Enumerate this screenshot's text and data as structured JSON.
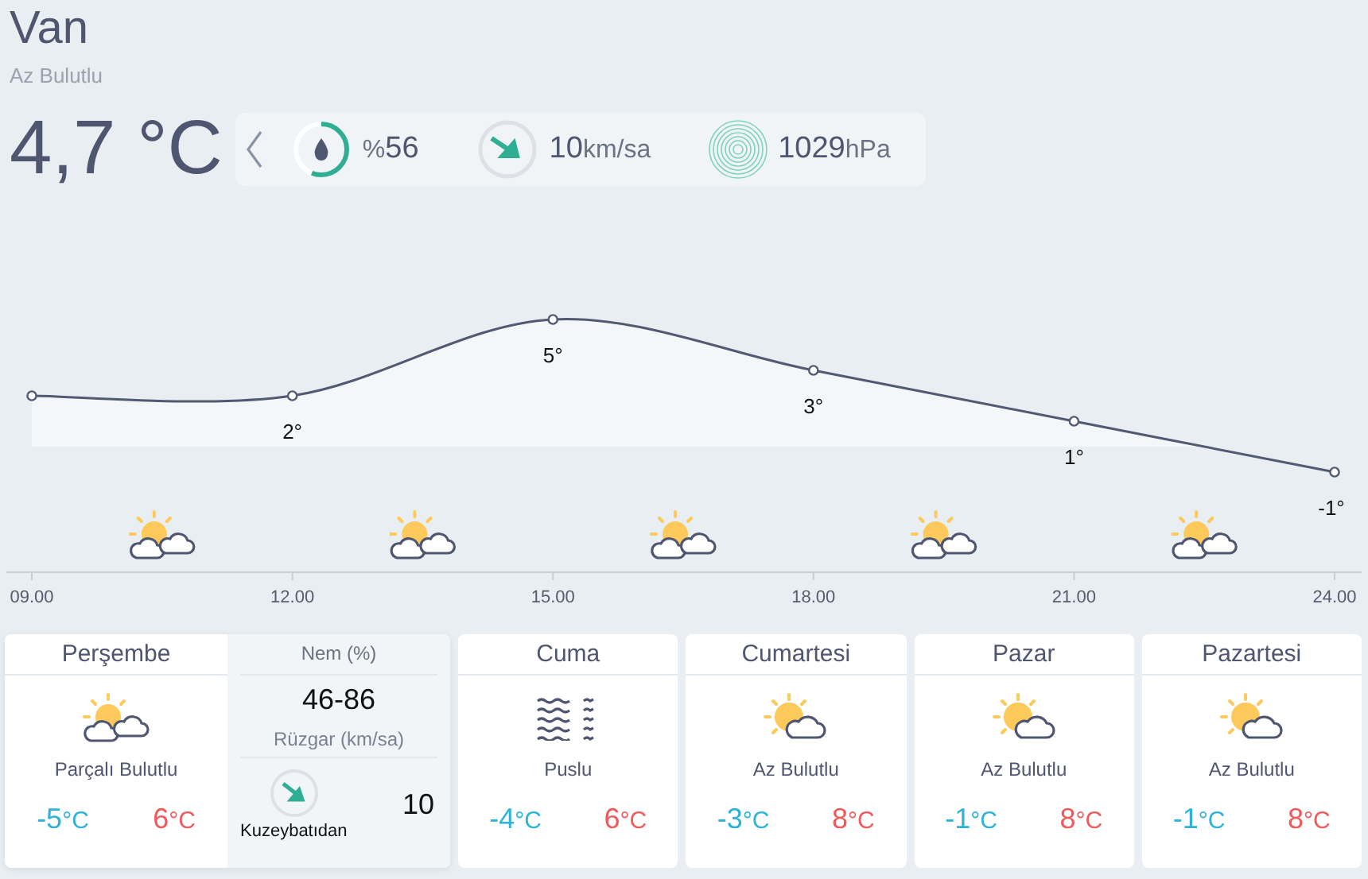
{
  "city": "Van",
  "condition": "Az Bulutlu",
  "temperature": "4,7 °C",
  "stats": {
    "humidity": {
      "prefix": "%",
      "value": "56"
    },
    "wind": {
      "value": "10",
      "unit": "km/sa"
    },
    "pressure": {
      "value": "1029",
      "unit": "hPa"
    }
  },
  "hourly": {
    "chart_data": {
      "type": "area",
      "marker": true,
      "categories": [
        "09.00",
        "12.00",
        "15.00",
        "18.00",
        "21.00",
        "24.00"
      ],
      "values": [
        2,
        2,
        5,
        3,
        1,
        -1
      ],
      "value_labels": [
        null,
        "2°",
        "5°",
        "3°",
        "1°",
        "-1°"
      ]
    },
    "icons": [
      {
        "kind": "partly_cloudy"
      },
      {
        "kind": "partly_cloudy"
      },
      {
        "kind": "partly_cloudy"
      },
      {
        "kind": "partly_cloudy"
      },
      {
        "kind": "partly_cloudy"
      }
    ]
  },
  "days": [
    {
      "name": "Perşembe",
      "kind": "partly_cloudy",
      "condition": "Parçalı Bulutlu",
      "low": "-5",
      "low_unit": "°C",
      "high": "6",
      "high_unit": "°C",
      "selected": true,
      "details": {
        "humidity_label": "Nem (%)",
        "humidity": "46-86",
        "wind_label": "Rüzgar (km/sa)",
        "wind_direction": "Kuzeybatıdan",
        "wind_speed": "10"
      }
    },
    {
      "name": "Cuma",
      "kind": "fog",
      "condition": "Puslu",
      "low": "-4",
      "low_unit": "°C",
      "high": "6",
      "high_unit": "°C",
      "selected": false
    },
    {
      "name": "Cumartesi",
      "kind": "mostly_sunny",
      "condition": "Az Bulutlu",
      "low": "-3",
      "low_unit": "°C",
      "high": "8",
      "high_unit": "°C",
      "selected": false
    },
    {
      "name": "Pazar",
      "kind": "mostly_sunny",
      "condition": "Az Bulutlu",
      "low": "-1",
      "low_unit": "°C",
      "high": "8",
      "high_unit": "°C",
      "selected": false
    },
    {
      "name": "Pazartesi",
      "kind": "mostly_sunny",
      "condition": "Az Bulutlu",
      "low": "-1",
      "low_unit": "°C",
      "high": "8",
      "high_unit": "°C",
      "selected": false
    }
  ]
}
